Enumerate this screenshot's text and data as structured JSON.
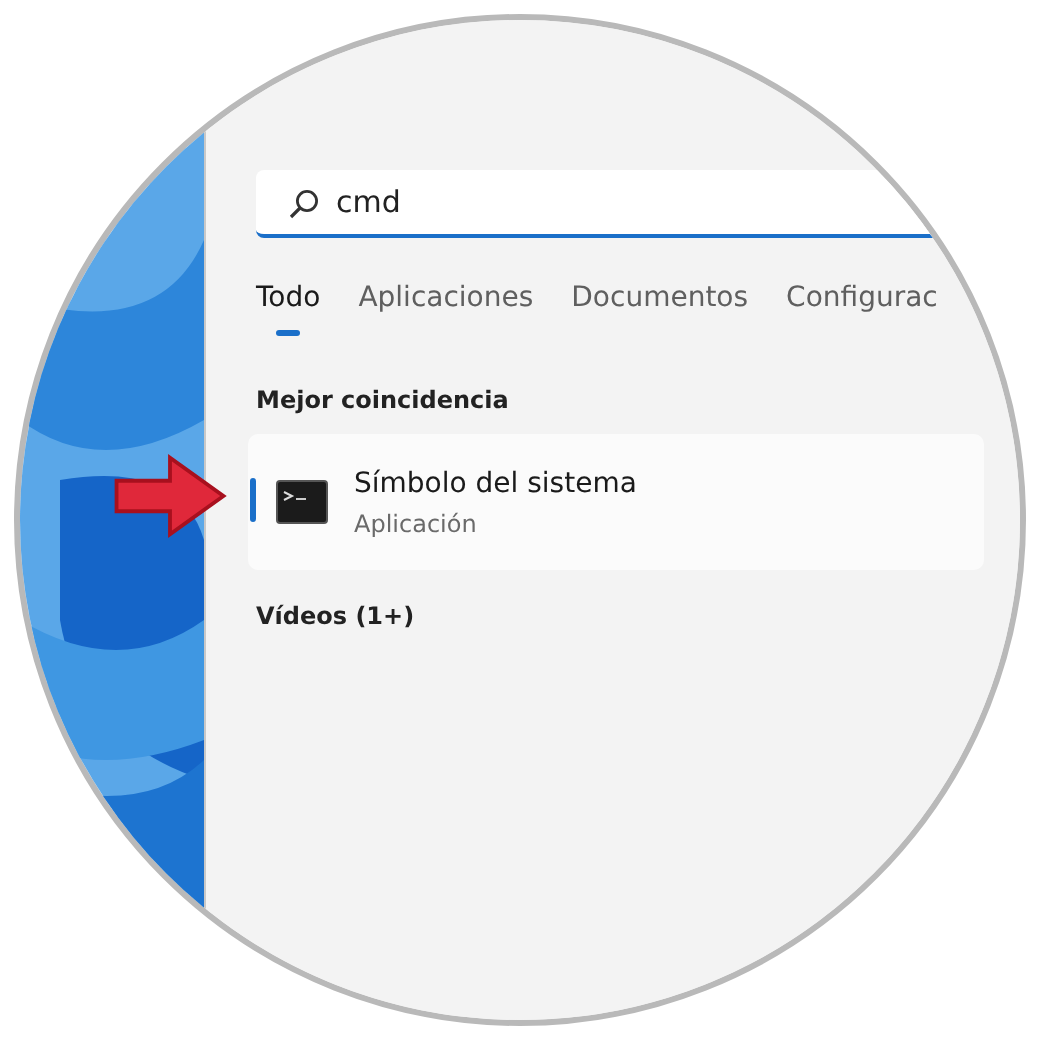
{
  "search": {
    "value": "cmd"
  },
  "tabs": [
    {
      "label": "Todo",
      "selected": true
    },
    {
      "label": "Aplicaciones",
      "selected": false
    },
    {
      "label": "Documentos",
      "selected": false
    },
    {
      "label": "Configurac",
      "selected": false
    }
  ],
  "best_match": {
    "heading": "Mejor coincidencia",
    "result": {
      "title": "Símbolo del sistema",
      "subtitle": "Aplicación",
      "selected": true
    }
  },
  "videos": {
    "heading": "Vídeos (1+)"
  }
}
